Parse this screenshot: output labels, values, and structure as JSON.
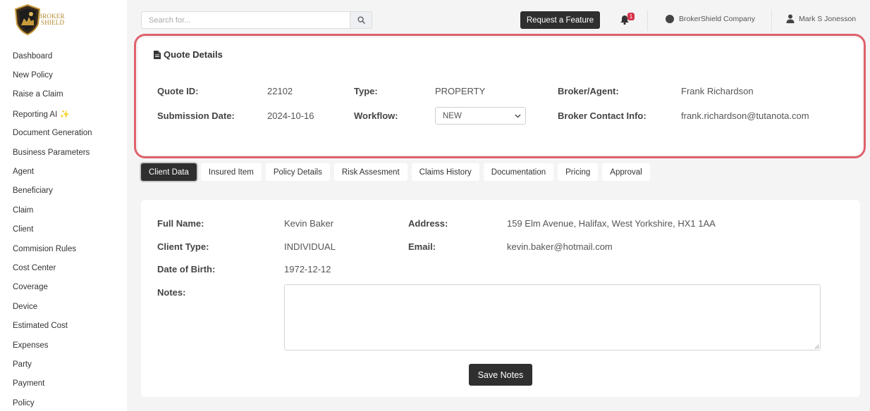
{
  "brand": {
    "logo_line1": "BROKER",
    "logo_line2": "SHIELD"
  },
  "sidebar": {
    "items": [
      {
        "label": "Dashboard"
      },
      {
        "label": "New Policy"
      },
      {
        "label": "Raise a Claim"
      },
      {
        "label": "Reporting AI ✨"
      },
      {
        "label": "Document Generation"
      },
      {
        "label": "Business Parameters"
      },
      {
        "label": "Agent"
      },
      {
        "label": "Beneficiary"
      },
      {
        "label": "Claim"
      },
      {
        "label": "Client"
      },
      {
        "label": "Commision Rules"
      },
      {
        "label": "Cost Center"
      },
      {
        "label": "Coverage"
      },
      {
        "label": "Device"
      },
      {
        "label": "Estimated Cost"
      },
      {
        "label": "Expenses"
      },
      {
        "label": "Party"
      },
      {
        "label": "Payment"
      },
      {
        "label": "Policy"
      }
    ]
  },
  "topbar": {
    "search_placeholder": "Search for...",
    "request_feature": "Request a Feature",
    "notification_count": "1",
    "company": "BrokerShield Company",
    "user": "Mark S Jonesson"
  },
  "quote": {
    "title": "Quote Details",
    "quote_id_label": "Quote ID:",
    "quote_id": "22102",
    "type_label": "Type:",
    "type": "PROPERTY",
    "broker_label": "Broker/Agent:",
    "broker": "Frank Richardson",
    "submission_label": "Submission Date:",
    "submission_date": "2024-10-16",
    "workflow_label": "Workflow:",
    "workflow": "NEW",
    "broker_contact_label": "Broker Contact Info:",
    "broker_contact": "frank.richardson@tutanota.com"
  },
  "tabs": [
    {
      "label": "Client Data"
    },
    {
      "label": "Insured Item"
    },
    {
      "label": "Policy Details"
    },
    {
      "label": "Risk Assesment"
    },
    {
      "label": "Claims History"
    },
    {
      "label": "Documentation"
    },
    {
      "label": "Pricing"
    },
    {
      "label": "Approval"
    }
  ],
  "client": {
    "full_name_label": "Full Name:",
    "full_name": "Kevin Baker",
    "client_type_label": "Client Type:",
    "client_type": "INDIVIDUAL",
    "dob_label": "Date of Birth:",
    "dob": "1972-12-12",
    "notes_label": "Notes:",
    "notes": "",
    "address_label": "Address:",
    "address": "159 Elm Avenue, Halifax, West Yorkshire, HX1 1AA",
    "email_label": "Email:",
    "email": "kevin.baker@hotmail.com",
    "save_notes": "Save Notes"
  },
  "colors": {
    "accent_dark": "#2f2f2f",
    "highlight": "#e0616c",
    "badge": "#d6334a",
    "logo_gold": "#b48a2c"
  }
}
